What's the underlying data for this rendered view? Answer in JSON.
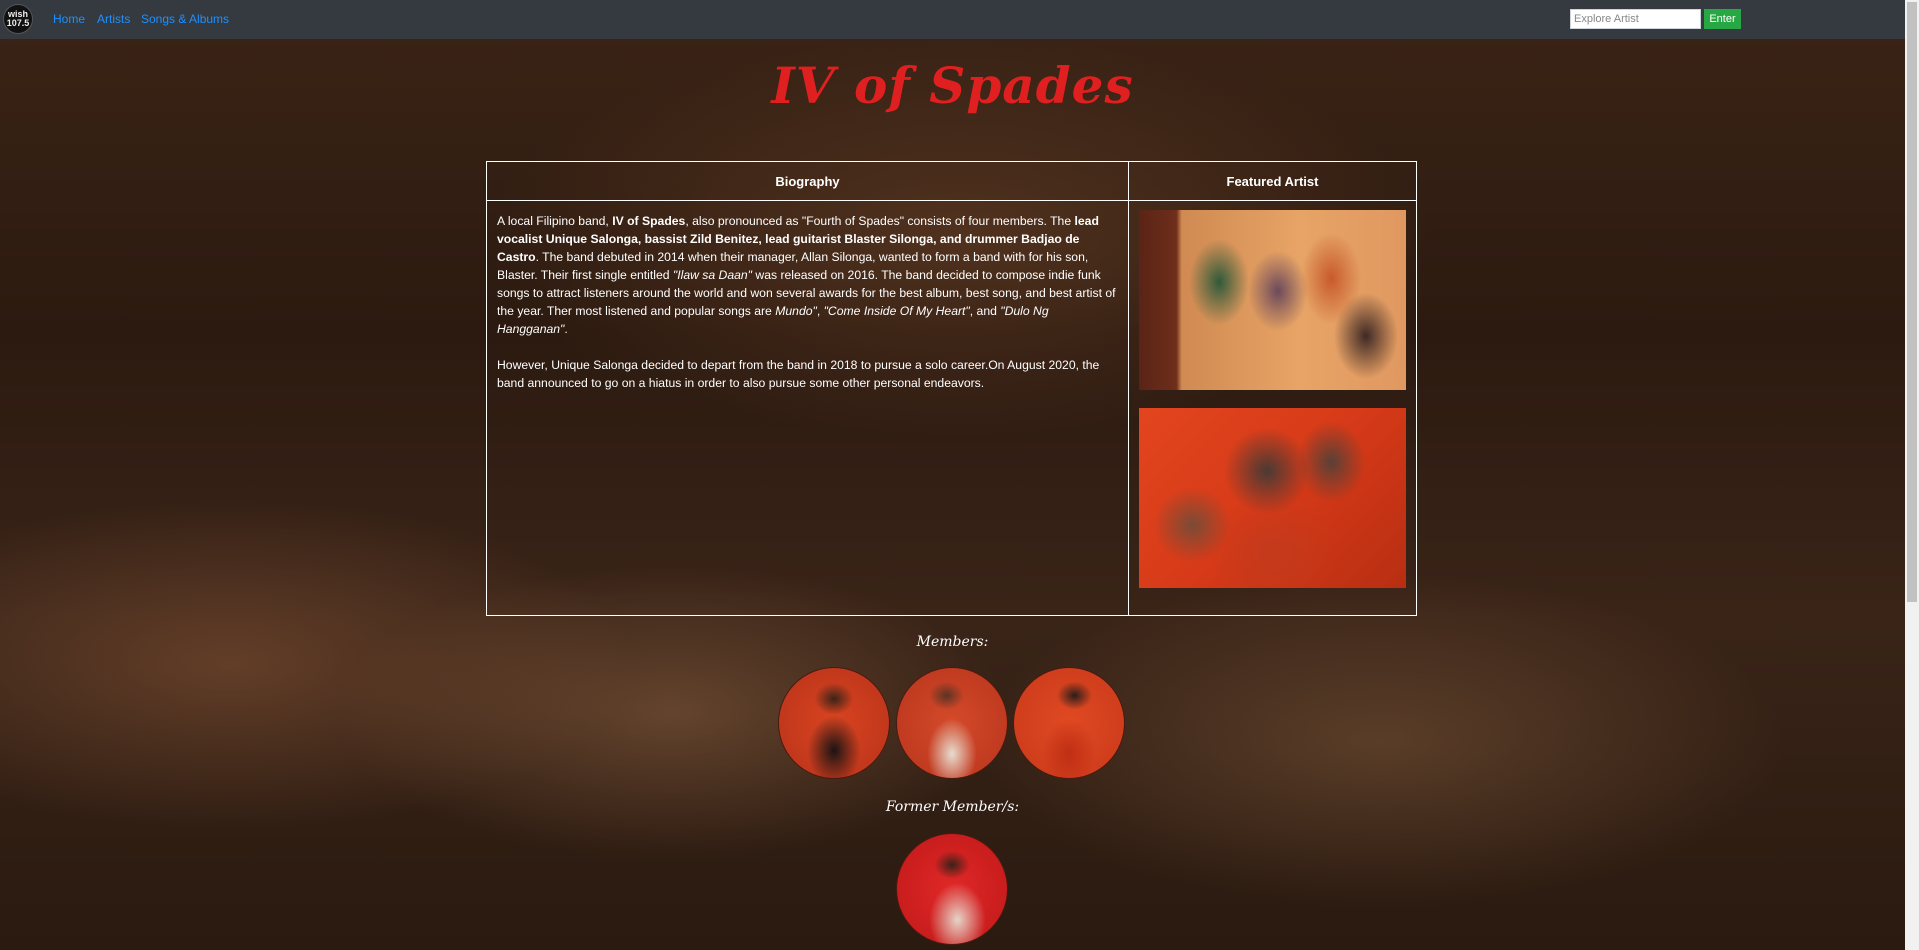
{
  "navbar": {
    "logo_text": "wish 107.5",
    "links": [
      "Home",
      "Artists",
      "Songs & Albums"
    ],
    "search_placeholder": "Explore Artist",
    "enter_label": "Enter"
  },
  "page_title": "IV of Spades",
  "table": {
    "bio_header": "Biography",
    "featured_header": "Featured Artist",
    "bio_p1_parts": [
      "A local Filipino band, ",
      "IV of Spades",
      ", also pronounced as \"Fourth of Spades\" consists of four members. The ",
      "lead vocalist Unique Salonga, bassist Zild Benitez, lead guitarist Blaster Silonga, and drummer Badjao de Castro",
      ". The band debuted in 2014 when their manager, Allan Silonga, wanted to form a band with for his son, Blaster. Their first single entitled ",
      "\"Ilaw sa Daan\"",
      " was released on 2016. The band decided to compose indie funk songs to attract listeners around the world and won several awards for the best album, best song, and best artist of the year. Ther most listened and popular songs are ",
      "Mundo\"",
      ", ",
      "\"Come Inside Of My Heart\"",
      ", and ",
      "\"Dulo Ng Hangganan\"",
      "."
    ],
    "bio_p2": "However, Unique Salonga decided to depart from the band in 2018 to pursue a solo career.On August 2020, the band announced to go on a hiatus in order to also pursue some other personal endeavors."
  },
  "members_label": "Members:",
  "former_members_label": "Former Member/s:"
}
